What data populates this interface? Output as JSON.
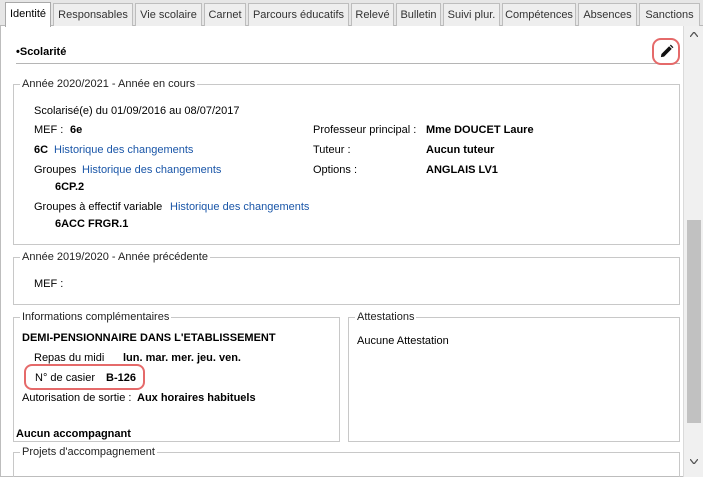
{
  "tabs": [
    {
      "label": "Identité",
      "active": true
    },
    {
      "label": "Responsables"
    },
    {
      "label": "Vie scolaire"
    },
    {
      "label": "Carnet"
    },
    {
      "label": "Parcours éducatifs"
    },
    {
      "label": "Relevé"
    },
    {
      "label": "Bulletin"
    },
    {
      "label": "Suivi plur."
    },
    {
      "label": "Compétences"
    },
    {
      "label": "Absences"
    },
    {
      "label": "Sanctions"
    }
  ],
  "section": {
    "title": "•Scolarité",
    "edit_icon": "pencil-icon"
  },
  "current_year": {
    "legend": "Année 2020/2021 - Année en cours",
    "schooled": "Scolarisé(e) du 01/09/2016 au 08/07/2017",
    "mef_label": "MEF :",
    "mef_value": "6e",
    "class_value": "6C",
    "class_history_link": "Historique des changements",
    "groups_label": "Groupes",
    "groups_history_link": "Historique des changements",
    "groups_value": "6CP.2",
    "variable_groups_label": "Groupes à effectif variable",
    "variable_groups_history_link": "Historique des changements",
    "variable_groups_value": "6ACC FRGR.1",
    "head_teacher_label": "Professeur principal :",
    "head_teacher_value": "Mme DOUCET Laure",
    "tutor_label": "Tuteur :",
    "tutor_value": "Aucun tuteur",
    "options_label": "Options :",
    "options_value": "ANGLAIS LV1"
  },
  "previous_year": {
    "legend": "Année 2019/2020 - Année précédente",
    "mef_label": "MEF :"
  },
  "complementary": {
    "legend": "Informations complémentaires",
    "status": "DEMI-PENSIONNAIRE DANS L'ETABLISSEMENT",
    "lunch_label": "Repas du midi",
    "lunch_value": "lun. mar. mer. jeu. ven.",
    "locker_label": "N° de casier",
    "locker_value": "B-126",
    "exit_label": "Autorisation de sortie :",
    "exit_value": "Aux horaires habituels"
  },
  "attestations": {
    "legend": "Attestations",
    "value": "Aucune Attestation"
  },
  "support": {
    "none_label": "Aucun accompagnant",
    "projects_legend": "Projets d'accompagnement"
  },
  "colors": {
    "link": "#1a56a8",
    "highlight": "#e56a6a"
  }
}
